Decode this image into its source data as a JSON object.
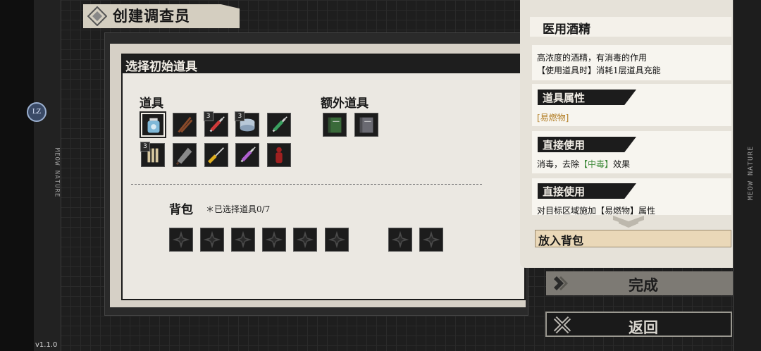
{
  "app": {
    "title": "创建调查员",
    "version": "v1.1.0",
    "brand": "MEOW NATURE",
    "avatar_text": "LZ"
  },
  "panel": {
    "title": "选择初始道具",
    "items_label": "道具",
    "extra_items_label": "额外道具",
    "items": [
      {
        "icon": "alcohol-bottle-icon",
        "count": "",
        "color": "#7fb8d8"
      },
      {
        "icon": "wooden-sticks-icon",
        "count": "",
        "color": "#8a4a2a"
      },
      {
        "icon": "red-syringe-icon",
        "count": "3",
        "color": "#d03a3a"
      },
      {
        "icon": "bandage-tin-icon",
        "count": "3",
        "color": "#b8c8d8"
      },
      {
        "icon": "green-syringe-icon",
        "count": "",
        "color": "#3aa060"
      },
      {
        "icon": "bone-bundle-icon",
        "count": "3",
        "color": "#d8c8a0"
      },
      {
        "icon": "rusty-blade-icon",
        "count": "",
        "color": "#8a8a8a"
      },
      {
        "icon": "screwdriver-icon",
        "count": "",
        "color": "#e0b020"
      },
      {
        "icon": "purple-syringe-icon",
        "count": "",
        "color": "#b060d0"
      },
      {
        "icon": "red-figure-icon",
        "count": "",
        "color": "#a02020"
      }
    ],
    "extra_items": [
      {
        "icon": "green-book-icon",
        "color": "#3a6a3a"
      },
      {
        "icon": "gray-book-icon",
        "color": "#6a6a72"
      }
    ],
    "backpack_label": "背包",
    "backpack_count": "＊已选择道具0/7",
    "backpack_slots": 8
  },
  "detail": {
    "item_name": "医用酒精",
    "desc_line1": "高浓度的酒精，有消毒的作用",
    "desc_line2": "【使用道具时】消耗1层道具充能",
    "cards": [
      {
        "head": "道具属性",
        "body": "[易燃物]",
        "tone": "orange"
      },
      {
        "head": "直接使用",
        "body_pre": "消毒，去除",
        "body_tag": "【中毒】",
        "body_post": "效果",
        "tone": "green"
      },
      {
        "head": "直接使用",
        "body": "对目标区域施加【易燃物】属性",
        "tone": "plain"
      }
    ],
    "add_to_bag": "放入背包"
  },
  "buttons": {
    "done": "完成",
    "back": "返回"
  }
}
